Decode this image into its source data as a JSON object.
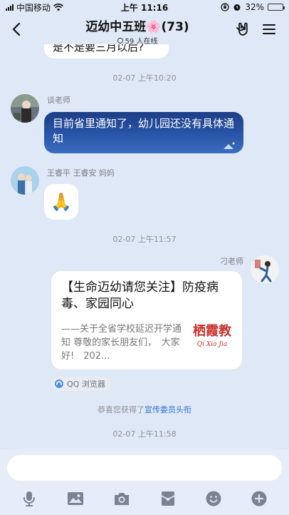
{
  "status_bar": {
    "carrier": "中国移动",
    "time": "上午 11:16",
    "battery": "32%",
    "battery_level": 0.32
  },
  "header": {
    "title": "迈幼中五班🌸(73)",
    "online": "59 人在线",
    "icons": [
      "back-icon",
      "rock-hand-icon",
      "menu-icon"
    ]
  },
  "chat": {
    "partial_message": "是不是要三月以后?",
    "timestamps": [
      "02-07 上午10:20",
      "02-07 上午11:57",
      "02-07 上午11:58"
    ],
    "messages": [
      {
        "sender": "谈老师",
        "text": "目前省里通知了，幼儿园还没有具体通知"
      },
      {
        "sender": "王睿平 王睿安 妈妈",
        "emoji": "🙏"
      },
      {
        "sender": "刁老师",
        "card": {
          "title": "【生命迈幼请您关注】防疫病毒、家园同心",
          "description": "——关于全省学校延迟开学通知 尊敬的家长朋友们，　大家好!　202...",
          "thumb_text": "栖霞教",
          "thumb_pinyin": "Qi Xia Jia"
        },
        "source": "QQ 浏览器"
      }
    ],
    "system_message": {
      "prefix": "恭喜您获得了",
      "link": "宣传委员头衔"
    }
  },
  "input_bar": {
    "placeholder": "",
    "tools": [
      "microphone-icon",
      "image-icon",
      "camera-icon",
      "red-packet-icon",
      "emoji-icon",
      "plus-icon"
    ]
  },
  "colors": {
    "background": "#dfe8f6",
    "link": "#2d6fd6",
    "bubble_blue": "#2a55a8"
  }
}
